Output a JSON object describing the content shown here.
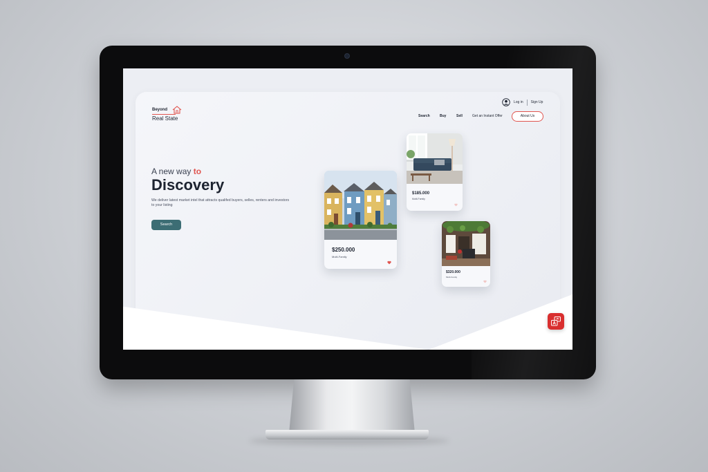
{
  "brand": {
    "name_top": "Beyond",
    "name_bottom": "Real State",
    "accent_color": "#e0544e",
    "primary_color": "#3c6d74"
  },
  "header": {
    "login_label": "Log in",
    "signup_label": "Sign Up",
    "nav": {
      "search": "Search",
      "buy": "Buy",
      "sell": "Sell",
      "offer": "Get an Instant Offer"
    },
    "about_label": "About Us"
  },
  "hero": {
    "line1_prefix": "A new way ",
    "line1_accent": "to",
    "title": "Discovery",
    "description": "We deliver latest market intel that attracts qualifed buyers, selles, renters and investors to your listing",
    "search_label": "Search"
  },
  "listings": [
    {
      "price": "$250.000",
      "type": "Multi-Family",
      "photo": "row-houses"
    },
    {
      "price": "$185.000",
      "type": "Multi-Family",
      "photo": "living-room"
    },
    {
      "price": "$320.000",
      "type": "Multi-Family",
      "photo": "interior-plants"
    }
  ],
  "icons": {
    "account": "user-circle-icon",
    "favorite": "heart-icon",
    "translate": "translate-icon"
  }
}
